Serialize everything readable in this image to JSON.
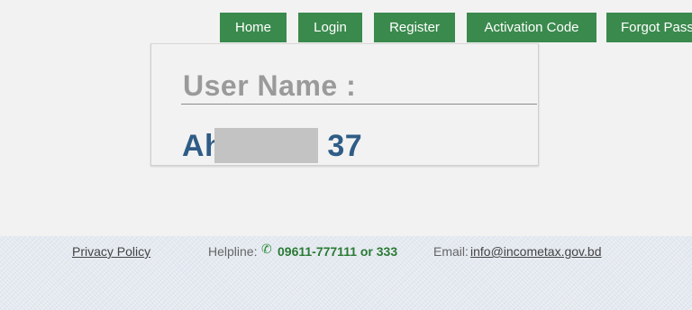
{
  "nav": {
    "home": "Home",
    "login": "Login",
    "register": "Register",
    "activation_code": "Activation Code",
    "forgot_password": "Forgot Password"
  },
  "card": {
    "label": "User Name :",
    "value_prefix": "Ah",
    "value_suffix": "37"
  },
  "footer": {
    "privacy_policy": "Privacy Policy",
    "helpline_label": "Helpline:",
    "phone_icon": "✆",
    "helpline_number": "09611-777111 or 333",
    "email_label": "Email:",
    "email": "info@incometax.gov.bd"
  },
  "colors": {
    "nav_bg": "#3b8a4d",
    "label": "#9a9a9a",
    "value": "#2f5c86",
    "helpline": "#2a7a34"
  }
}
